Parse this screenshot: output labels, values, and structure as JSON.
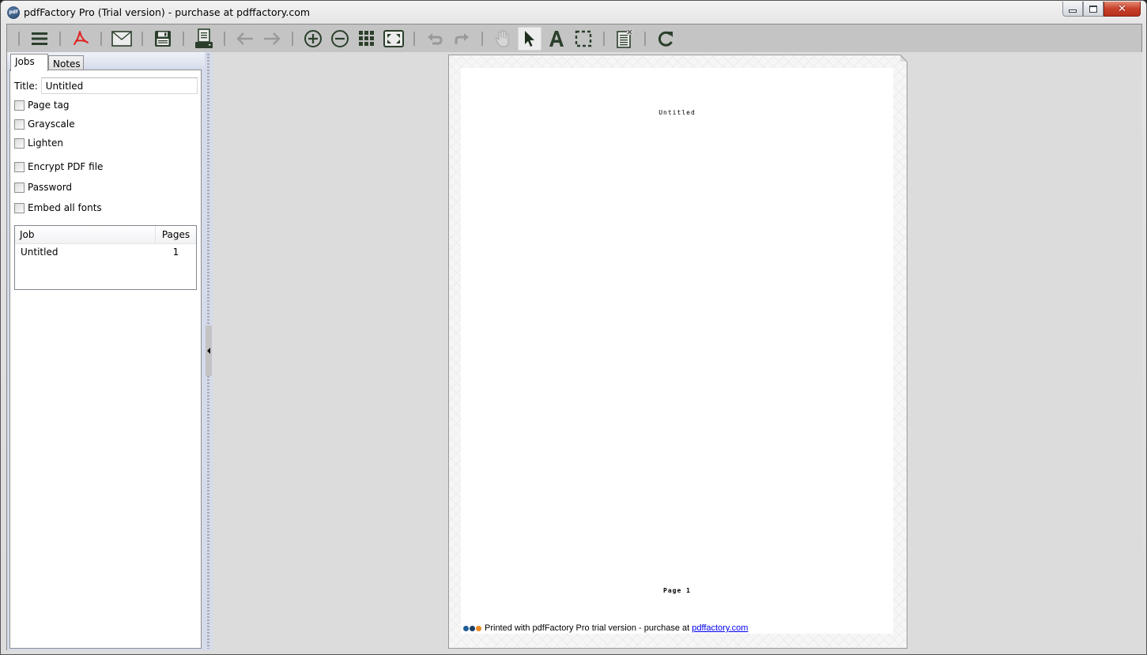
{
  "window": {
    "title": "pdfFactory Pro (Trial version) - purchase at pdffactory.com",
    "app_icon": "pdf",
    "controls": [
      "minimize",
      "maximize",
      "close"
    ]
  },
  "toolbar": {
    "items": [
      {
        "name": "menu",
        "icon": "hamburger-icon",
        "enabled": true
      },
      {
        "name": "acrobat",
        "icon": "acrobat-icon",
        "enabled": true
      },
      {
        "name": "email",
        "icon": "envelope-icon",
        "enabled": true
      },
      {
        "name": "save",
        "icon": "floppy-icon",
        "enabled": true
      },
      {
        "name": "print",
        "icon": "printer-icon",
        "enabled": true
      },
      {
        "name": "back",
        "icon": "arrow-left-icon",
        "enabled": false
      },
      {
        "name": "forward",
        "icon": "arrow-right-icon",
        "enabled": false
      },
      {
        "name": "zoom-in",
        "icon": "zoom-in-icon",
        "enabled": true
      },
      {
        "name": "zoom-out",
        "icon": "zoom-out-icon",
        "enabled": true
      },
      {
        "name": "thumbnails",
        "icon": "grid-icon",
        "enabled": true
      },
      {
        "name": "fit-page",
        "icon": "fit-page-icon",
        "enabled": true
      },
      {
        "name": "undo",
        "icon": "undo-icon",
        "enabled": false
      },
      {
        "name": "redo",
        "icon": "redo-icon",
        "enabled": false
      },
      {
        "name": "hand",
        "icon": "hand-icon",
        "enabled": false
      },
      {
        "name": "select",
        "icon": "pointer-icon",
        "enabled": true,
        "active": true
      },
      {
        "name": "text",
        "icon": "text-A-icon",
        "enabled": true
      },
      {
        "name": "marquee",
        "icon": "marquee-icon",
        "enabled": true
      },
      {
        "name": "delete-page",
        "icon": "page-delete-icon",
        "enabled": true
      },
      {
        "name": "refresh",
        "icon": "refresh-icon",
        "enabled": true
      }
    ],
    "icon_color": "#2b3f2b",
    "disabled_color": "#9a9a9a",
    "acrobat_color": "#e0201f"
  },
  "sidebar": {
    "tabs": [
      {
        "label": "Jobs",
        "active": true
      },
      {
        "label": "Notes",
        "active": false
      }
    ],
    "title_label": "Title:",
    "title_value": "Untitled",
    "checkboxes": [
      {
        "label": "Page tag",
        "checked": false
      },
      {
        "label": "Grayscale",
        "checked": false
      },
      {
        "label": "Lighten",
        "checked": false
      },
      {
        "label": "Encrypt PDF file",
        "checked": false
      },
      {
        "label": "Password",
        "checked": false
      },
      {
        "label": "Embed all fonts",
        "checked": false
      }
    ],
    "job_table": {
      "columns": [
        "Job",
        "Pages"
      ],
      "rows": [
        {
          "job": "Untitled",
          "pages": "1"
        }
      ]
    }
  },
  "document": {
    "header_text": "Untitled",
    "page_label": "Page 1",
    "footer_text": "Printed with pdfFactory Pro trial version - purchase at",
    "footer_link": "pdffactory.com",
    "footer_dot_colors": [
      "#1f5e97",
      "#1c3f66",
      "#f08a24"
    ]
  }
}
